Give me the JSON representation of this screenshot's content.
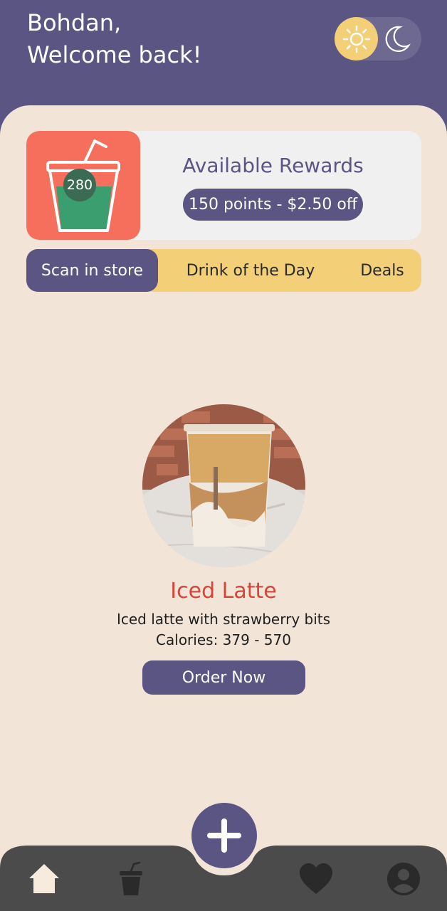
{
  "header": {
    "greeting_line1": "Bohdan,",
    "greeting_line2": "Welcome back!",
    "theme_toggle": {
      "sun_icon": "sun-icon",
      "moon_icon": "moon-icon",
      "mode": "light"
    }
  },
  "rewards": {
    "points": "280",
    "title": "Available Rewards",
    "offer": "150 points - $2.50 off"
  },
  "tabs": [
    {
      "label": "Scan in store",
      "active": true
    },
    {
      "label": "Drink of the Day",
      "active": false
    },
    {
      "label": "Deals",
      "active": false
    }
  ],
  "drink": {
    "name": "Iced Latte",
    "description": "Iced latte with strawberry bits",
    "calories": "Calories: 379 - 570",
    "order_label": "Order Now"
  },
  "nav": {
    "items": [
      "home-icon",
      "drink-cup-icon",
      "add-icon",
      "heart-icon",
      "profile-icon"
    ]
  },
  "colors": {
    "primary": "#5a5583",
    "background": "#f2e5d8",
    "accent_yellow": "#f3cf78",
    "accent_red": "#f56f5c",
    "drink_title": "#d6453a",
    "nav_bar": "#4b4b4b"
  }
}
